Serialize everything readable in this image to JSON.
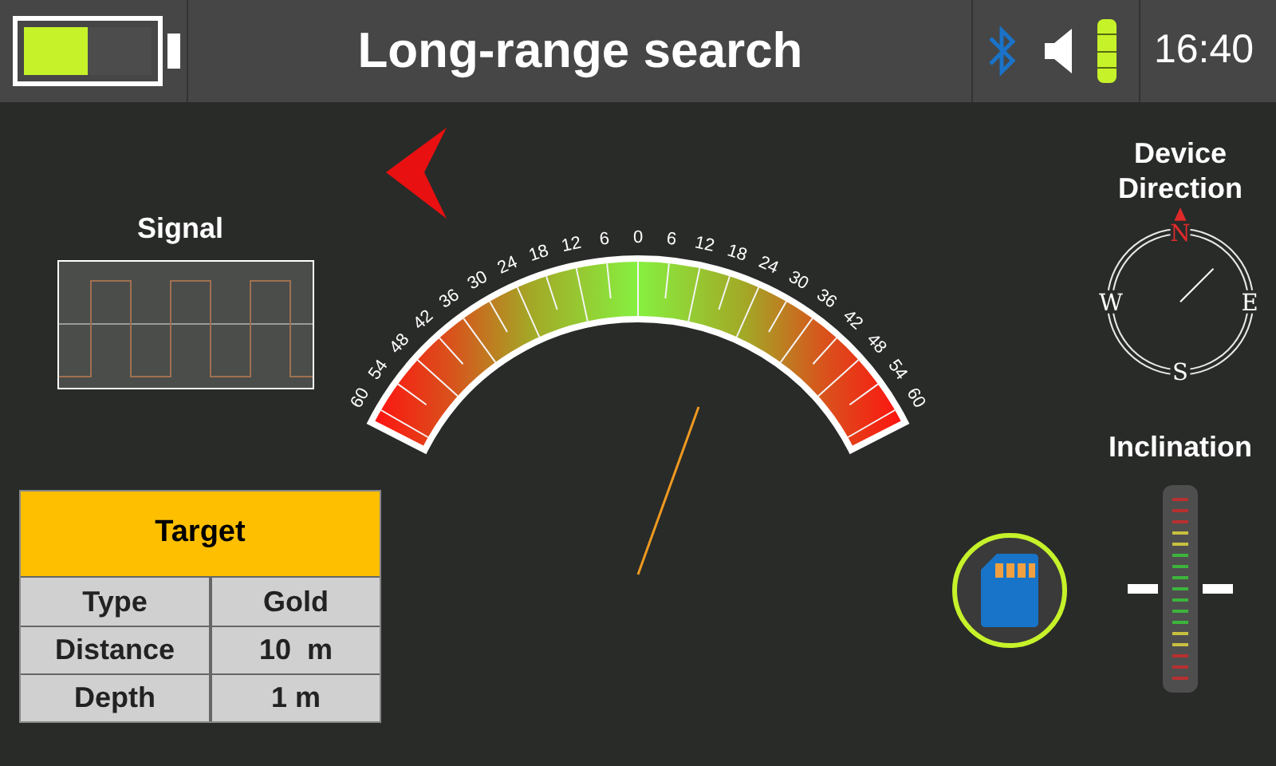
{
  "header": {
    "battery": {
      "level": 0.5
    },
    "title": "Long-range search",
    "time": "16:40"
  },
  "signal": {
    "label": "Signal"
  },
  "gauge": {
    "scale": [
      "60",
      "54",
      "48",
      "42",
      "36",
      "30",
      "24",
      "18",
      "12",
      "6",
      "0",
      "6",
      "12",
      "18",
      "24",
      "30",
      "36",
      "42",
      "48",
      "54",
      "60"
    ]
  },
  "compass": {
    "title": "Device Direction",
    "points": [
      {
        "text": "N",
        "color": "#e02a2a"
      },
      {
        "text": "E",
        "color": "#ffffff"
      },
      {
        "text": "S",
        "color": "#ffffff"
      },
      {
        "text": "W",
        "color": "#ffffff"
      }
    ]
  },
  "inclination": {
    "label": "Inclination"
  },
  "target": {
    "title": "Target",
    "rows": [
      {
        "label": "Type",
        "value": "Gold"
      },
      {
        "label": "Distance",
        "value": "10  m"
      },
      {
        "label": "Depth",
        "value": "1 m"
      }
    ]
  }
}
